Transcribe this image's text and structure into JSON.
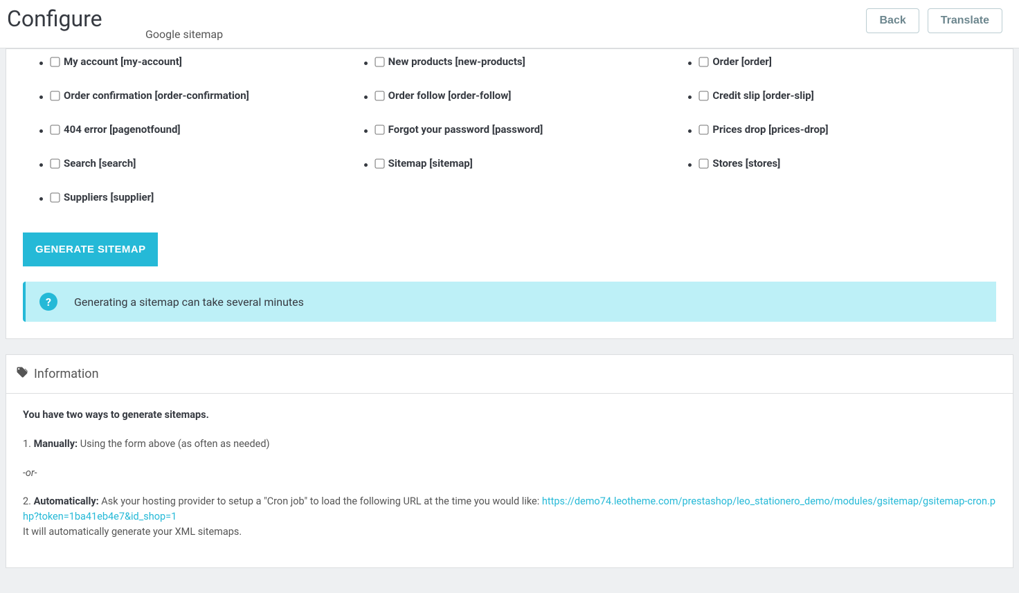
{
  "header": {
    "title": "Configure",
    "subtitle": "Google sitemap",
    "back_label": "Back",
    "translate_label": "Translate"
  },
  "pages_rows": [
    [
      {
        "label": "My account [my-account]",
        "slug": "my-account"
      },
      {
        "label": "New products [new-products]",
        "slug": "new-products"
      },
      {
        "label": "Order [order]",
        "slug": "order"
      }
    ],
    [
      {
        "label": "Order confirmation [order-confirmation]",
        "slug": "order-confirmation"
      },
      {
        "label": "Order follow [order-follow]",
        "slug": "order-follow"
      },
      {
        "label": "Credit slip [order-slip]",
        "slug": "order-slip"
      }
    ],
    [
      {
        "label": "404 error [pagenotfound]",
        "slug": "pagenotfound"
      },
      {
        "label": "Forgot your password [password]",
        "slug": "password"
      },
      {
        "label": "Prices drop [prices-drop]",
        "slug": "prices-drop"
      }
    ],
    [
      {
        "label": "Search [search]",
        "slug": "search"
      },
      {
        "label": "Sitemap [sitemap]",
        "slug": "sitemap"
      },
      {
        "label": "Stores [stores]",
        "slug": "stores"
      }
    ],
    [
      {
        "label": "Suppliers [supplier]",
        "slug": "supplier"
      },
      null,
      null
    ]
  ],
  "generate_button": "GENERATE SITEMAP",
  "alert_text": "Generating a sitemap can take several minutes",
  "info": {
    "heading": "Information",
    "intro": "You have two ways to generate sitemaps.",
    "manually_label": "Manually:",
    "manually_text": " Using the form above (as often as needed)",
    "or": "-or-",
    "auto_label": "Automatically:",
    "auto_text": " Ask your hosting provider to setup a \"Cron job\" to load the following URL at the time you would like: ",
    "cron_url": "https://demo74.leotheme.com/prestashop/leo_stationero_demo/modules/gsitemap/gsitemap-cron.php?token=1ba41eb4e7&id_shop=1",
    "auto_footer": "It will automatically generate your XML sitemaps."
  }
}
